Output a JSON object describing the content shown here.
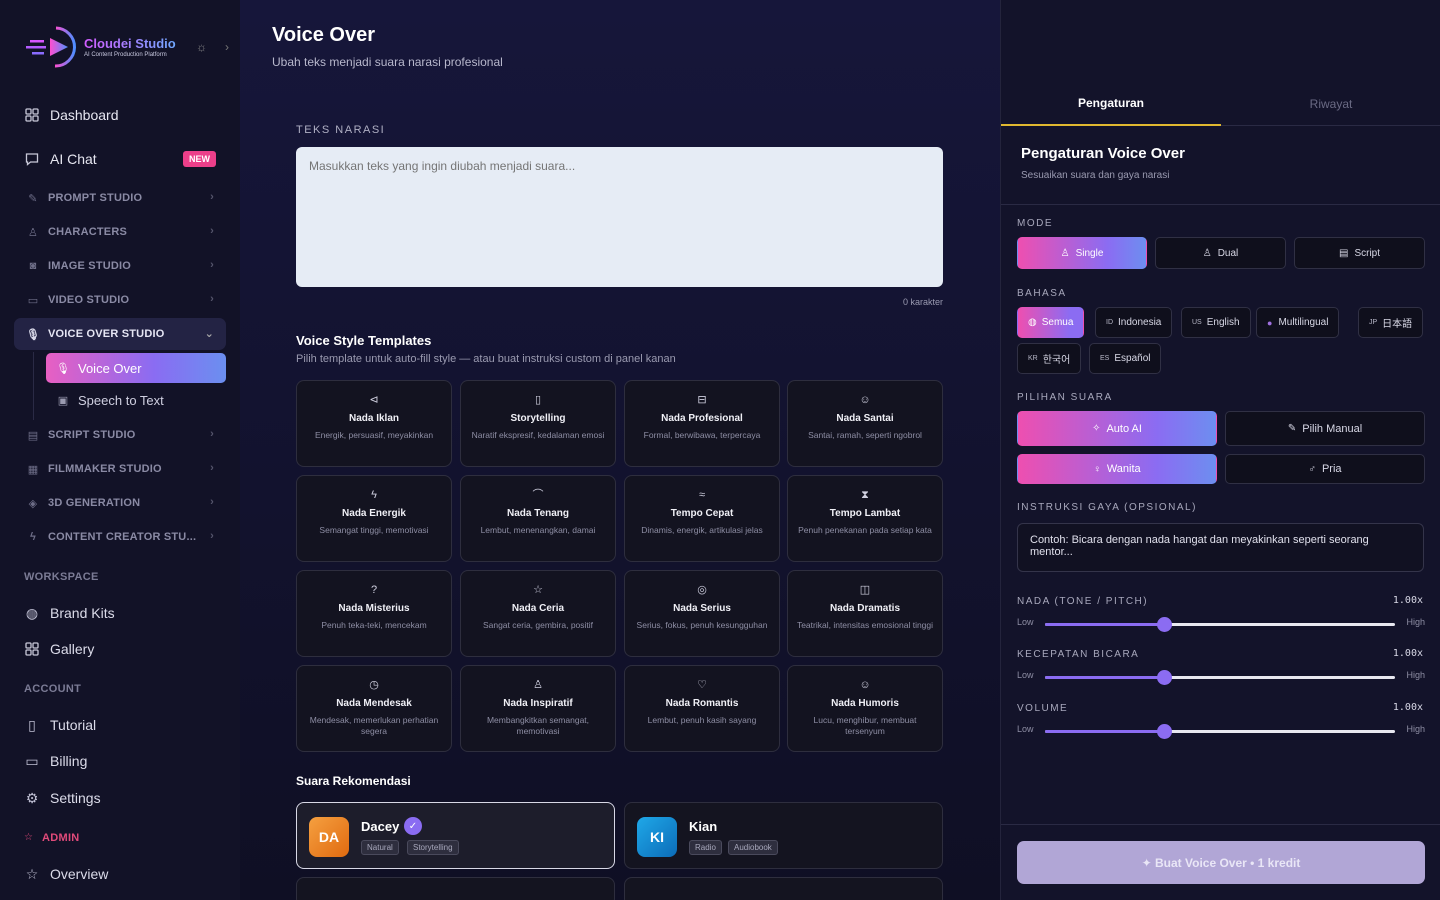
{
  "brand": {
    "title": "Cloudei Studio",
    "subtitle": "AI Content Production Platform"
  },
  "sidebar": {
    "top": [
      {
        "label": "Dashboard",
        "icon": "grid-icon"
      },
      {
        "label": "AI Chat",
        "icon": "chat-icon",
        "badge": "NEW"
      }
    ],
    "sections": [
      {
        "label": "PROMPT STUDIO",
        "icon": "pen-icon"
      },
      {
        "label": "CHARACTERS",
        "icon": "user-icon"
      },
      {
        "label": "IMAGE STUDIO",
        "icon": "camera-icon"
      },
      {
        "label": "VIDEO STUDIO",
        "icon": "video-icon"
      },
      {
        "label": "VOICE OVER STUDIO",
        "icon": "mic-icon",
        "active": true
      },
      {
        "label": "SCRIPT STUDIO",
        "icon": "doc-icon"
      },
      {
        "label": "FILMMAKER STUDIO",
        "icon": "film-icon"
      },
      {
        "label": "3D GENERATION",
        "icon": "layers-icon"
      },
      {
        "label": "CONTENT CREATOR STU...",
        "icon": "bolt-icon"
      }
    ],
    "subitems": [
      {
        "label": "Voice Over",
        "icon": "mic-icon",
        "active": true
      },
      {
        "label": "Speech to Text",
        "icon": "wave-icon"
      }
    ],
    "workspace_label": "WORKSPACE",
    "workspace": [
      {
        "label": "Brand Kits",
        "icon": "palette-icon"
      },
      {
        "label": "Gallery",
        "icon": "grid-icon"
      }
    ],
    "account_label": "ACCOUNT",
    "account": [
      {
        "label": "Tutorial",
        "icon": "book-icon"
      },
      {
        "label": "Billing",
        "icon": "card-icon"
      },
      {
        "label": "Settings",
        "icon": "gear-icon"
      }
    ],
    "admin_label": "ADMIN",
    "admin": [
      {
        "label": "Overview",
        "icon": "star-icon"
      }
    ]
  },
  "main": {
    "title": "Voice Over",
    "subtitle": "Ubah teks menjadi suara narasi profesional",
    "narration_label": "TEKS NARASI",
    "narration_placeholder": "Masukkan teks yang ingin diubah menjadi suara...",
    "char_count": "0 karakter",
    "templates_title": "Voice Style Templates",
    "templates_subtitle": "Pilih template untuk auto-fill style — atau buat instruksi custom di panel kanan",
    "templates": [
      {
        "icon": "megaphone-icon",
        "glyph": "⊲",
        "title": "Nada Iklan",
        "desc": "Energik, persuasif, meyakinkan"
      },
      {
        "icon": "book-icon",
        "glyph": "▯",
        "title": "Storytelling",
        "desc": "Naratif ekspresif, kedalaman emosi"
      },
      {
        "icon": "briefcase-icon",
        "glyph": "⊟",
        "title": "Nada Profesional",
        "desc": "Formal, berwibawa, terpercaya"
      },
      {
        "icon": "smile-icon",
        "glyph": "☺",
        "title": "Nada Santai",
        "desc": "Santai, ramah, seperti ngobrol"
      },
      {
        "icon": "bolt-icon",
        "glyph": "ϟ",
        "title": "Nada Energik",
        "desc": "Semangat tinggi, memotivasi"
      },
      {
        "icon": "rainbow-icon",
        "glyph": "⌒",
        "title": "Nada Tenang",
        "desc": "Lembut, menenangkan, damai"
      },
      {
        "icon": "wind-icon",
        "glyph": "≈",
        "title": "Tempo Cepat",
        "desc": "Dinamis, energik, artikulasi jelas"
      },
      {
        "icon": "hourglass-icon",
        "glyph": "⧗",
        "title": "Tempo Lambat",
        "desc": "Penuh penekanan pada setiap kata"
      },
      {
        "icon": "question-icon",
        "glyph": "?",
        "title": "Nada Misterius",
        "desc": "Penuh teka-teki, mencekam"
      },
      {
        "icon": "star-icon",
        "glyph": "☆",
        "title": "Nada Ceria",
        "desc": "Sangat ceria, gembira, positif"
      },
      {
        "icon": "target-icon",
        "glyph": "◎",
        "title": "Nada Serius",
        "desc": "Serius, fokus, penuh kesungguhan"
      },
      {
        "icon": "masks-icon",
        "glyph": "◫",
        "title": "Nada Dramatis",
        "desc": "Teatrikal, intensitas emosional tinggi"
      },
      {
        "icon": "clock-icon",
        "glyph": "◷",
        "title": "Nada Mendesak",
        "desc": "Mendesak, memerlukan perhatian segera"
      },
      {
        "icon": "person-icon",
        "glyph": "♙",
        "title": "Nada Inspiratif",
        "desc": "Membangkitkan semangat, memotivasi"
      },
      {
        "icon": "heart-icon",
        "glyph": "♡",
        "title": "Nada Romantis",
        "desc": "Lembut, penuh kasih sayang"
      },
      {
        "icon": "laugh-icon",
        "glyph": "☺",
        "title": "Nada Humoris",
        "desc": "Lucu, menghibur, membuat tersenyum"
      }
    ],
    "recommended_title": "Suara Rekomendasi",
    "voices": [
      {
        "initials": "DA",
        "name": "Dacey",
        "tags": [
          "Natural",
          "Storytelling"
        ],
        "color": "#f08a2a",
        "selected": true
      },
      {
        "initials": "KI",
        "name": "Kian",
        "tags": [
          "Radio",
          "Audiobook"
        ],
        "color": "#1e8fd8",
        "selected": false
      }
    ]
  },
  "panel": {
    "tabs": [
      "Pengaturan",
      "Riwayat"
    ],
    "title": "Pengaturan Voice Over",
    "subtitle": "Sesuaikan suara dan gaya narasi",
    "mode_label": "MODE",
    "modes": [
      {
        "label": "Single",
        "icon": "user-icon",
        "glyph": "♙",
        "active": true
      },
      {
        "label": "Dual",
        "icon": "users-icon",
        "glyph": "♙",
        "active": false
      },
      {
        "label": "Script",
        "icon": "doc-icon",
        "glyph": "▤",
        "active": false
      }
    ],
    "language_label": "BAHASA",
    "languages": [
      {
        "code": "",
        "label": "Semua",
        "icon": "globe-icon",
        "active": true
      },
      {
        "code": "ID",
        "label": "Indonesia"
      },
      {
        "code": "US",
        "label": "English"
      },
      {
        "code": "",
        "label": "Multilingual",
        "icon": "blob-icon"
      },
      {
        "code": "JP",
        "label": "日本語"
      },
      {
        "code": "KR",
        "label": "한국어"
      },
      {
        "code": "ES",
        "label": "Español"
      }
    ],
    "voice_choice_label": "PILIHAN SUARA",
    "voice_choice": [
      {
        "label": "Auto AI",
        "glyph": "✧",
        "active": true
      },
      {
        "label": "Pilih Manual",
        "glyph": "✎",
        "active": false
      }
    ],
    "gender": [
      {
        "label": "Wanita",
        "glyph": "♀",
        "active": true
      },
      {
        "label": "Pria",
        "glyph": "♂",
        "active": false
      }
    ],
    "style_label": "INSTRUKSI GAYA (OPSIONAL)",
    "style_placeholder": "Contoh: Bicara dengan nada hangat dan meyakinkan seperti seorang mentor...",
    "sliders": [
      {
        "label": "NADA (TONE / PITCH)",
        "value_text": "1.00x",
        "low": "Low",
        "high": "High",
        "level": 0.34
      },
      {
        "label": "KECEPATAN BICARA",
        "value_text": "1.00x",
        "low": "Low",
        "high": "High",
        "level": 0.34
      },
      {
        "label": "VOLUME",
        "value_text": "1.00x",
        "low": "Low",
        "high": "High",
        "level": 0.34
      }
    ],
    "cta": "✦ Buat Voice Over • 1 kredit"
  }
}
